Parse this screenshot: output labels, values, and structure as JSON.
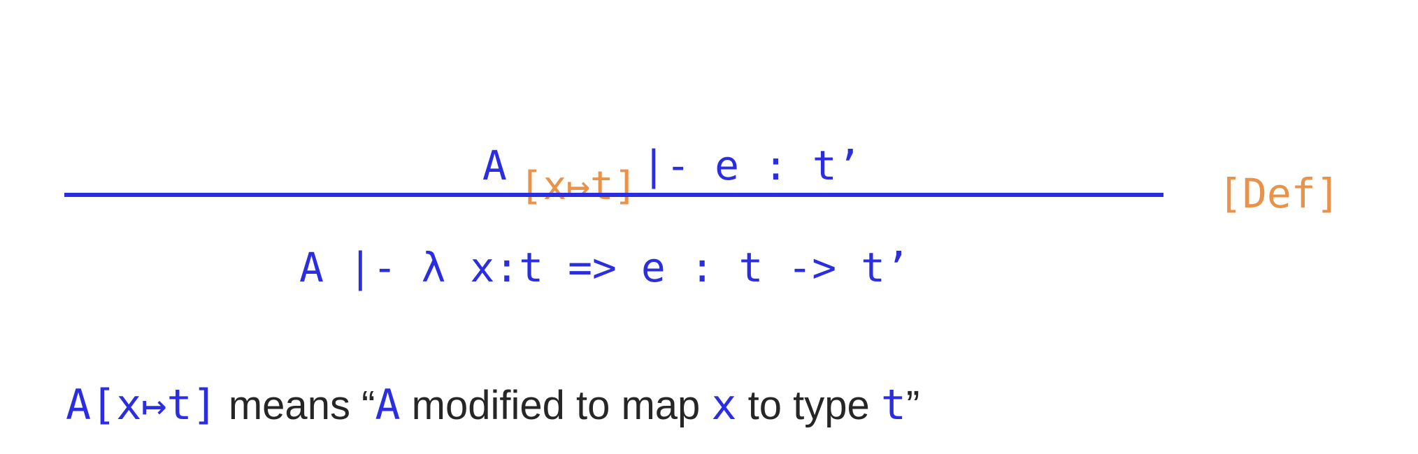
{
  "rule": {
    "premise": {
      "env": "A",
      "extension": "[x↦t]",
      "judgement": "|- e : t’"
    },
    "conclusion": "A |- λ x:t => e : t -> t’",
    "name": "[Def]"
  },
  "note": {
    "subject": "A[x↦t]",
    "text_1": " means “",
    "env": "A",
    "text_2": " modified to map ",
    "var": "x",
    "text_3": " to type ",
    "type": "t",
    "text_4": "”"
  },
  "colors": {
    "blue": "#2a2ee0",
    "orange": "#e8924a",
    "text": "#262626"
  }
}
